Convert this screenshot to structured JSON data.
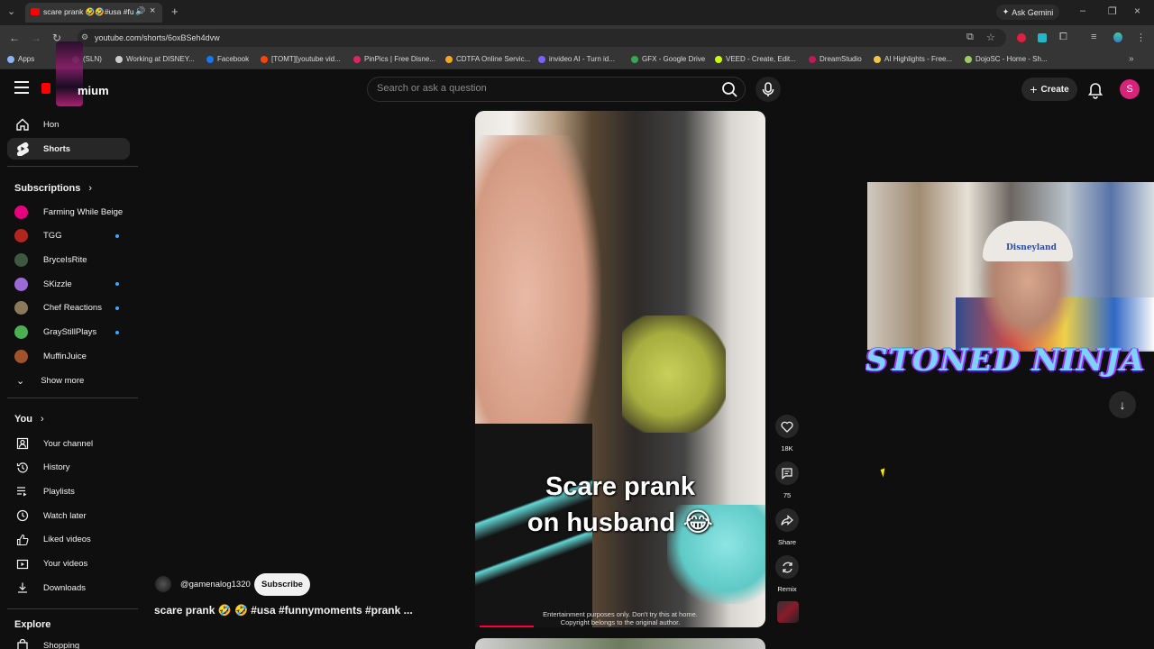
{
  "browser": {
    "tab_title": "scare prank 🤣🤣#usa #fu",
    "url": "youtube.com/shorts/6oxBSeh4dvw",
    "ask_gemini": "Ask Gemini",
    "bookmarks": [
      {
        "label": "Apps",
        "color": "#8ab4f8"
      },
      {
        "label": "(SLN)",
        "color": "#aaaaaa"
      },
      {
        "label": "Working at DISNEY...",
        "color": "#cccccc"
      },
      {
        "label": "Facebook",
        "color": "#1877f2"
      },
      {
        "label": "[TOMT][youtube vid...",
        "color": "#ff4500"
      },
      {
        "label": "PinPics | Free Disne...",
        "color": "#e0245e"
      },
      {
        "label": "CDTFA Online Servic...",
        "color": "#f5a623"
      },
      {
        "label": "invideo AI - Turn id...",
        "color": "#7b61ff"
      },
      {
        "label": "GFX - Google Drive",
        "color": "#34a853"
      },
      {
        "label": "VEED - Create, Edit...",
        "color": "#c8ff00"
      },
      {
        "label": "DreamStudio",
        "color": "#c2185b"
      },
      {
        "label": "AI Highlights - Free...",
        "color": "#f6c343"
      },
      {
        "label": "DojoSC - Home - Sh...",
        "color": "#9ccc65"
      }
    ]
  },
  "header": {
    "logo_text": "mium",
    "search_placeholder": "Search or ask a question",
    "create_label": "Create",
    "avatar_letter": "S"
  },
  "sidebar": {
    "top_items": [
      {
        "label": "Hon",
        "icon": "home-icon"
      },
      {
        "label": "Shorts",
        "icon": "shorts-icon"
      }
    ],
    "subscriptions_title": "Subscriptions",
    "subscriptions": [
      {
        "label": "Farming While Beige",
        "color": "#e6007e",
        "dot": false
      },
      {
        "label": "TGG",
        "color": "#b3261e",
        "dot": true
      },
      {
        "label": "BryceIsRite",
        "color": "#3d5a40",
        "dot": false
      },
      {
        "label": "SKizzle",
        "color": "#9c6ad6",
        "dot": true
      },
      {
        "label": "Chef Reactions",
        "color": "#8a7a5c",
        "dot": true
      },
      {
        "label": "GrayStillPlays",
        "color": "#4caf50",
        "dot": true
      },
      {
        "label": "MuffinJuice",
        "color": "#a0522d",
        "dot": false
      }
    ],
    "show_more": "Show more",
    "you_title": "You",
    "you_items": [
      {
        "label": "Your channel",
        "icon": "channel-icon"
      },
      {
        "label": "History",
        "icon": "history-icon"
      },
      {
        "label": "Playlists",
        "icon": "playlists-icon"
      },
      {
        "label": "Watch later",
        "icon": "watch-later-icon"
      },
      {
        "label": "Liked videos",
        "icon": "like-icon"
      },
      {
        "label": "Your videos",
        "icon": "your-videos-icon"
      },
      {
        "label": "Downloads",
        "icon": "download-icon"
      }
    ],
    "explore_title": "Explore",
    "explore_items": [
      {
        "label": "Shopping",
        "icon": "shopping-icon"
      }
    ]
  },
  "short": {
    "caption_line1": "Scare prank",
    "caption_line2": "on husband 😂",
    "disclaimer_line1": "Entertainment purposes only. Don't try this at home.",
    "disclaimer_line2": "Copyright belongs to the original author.",
    "likes": "18K",
    "comments": "75",
    "share_label": "Share",
    "remix_label": "Remix",
    "channel": "@gamenalog1320",
    "subscribe_label": "Subscribe",
    "title": "scare prank 🤣 🤣 #usa #funnymoments #prank ..."
  },
  "overlay": {
    "webcam_hat_text": "Disneyland",
    "banner_text": "STONED NINJA"
  }
}
